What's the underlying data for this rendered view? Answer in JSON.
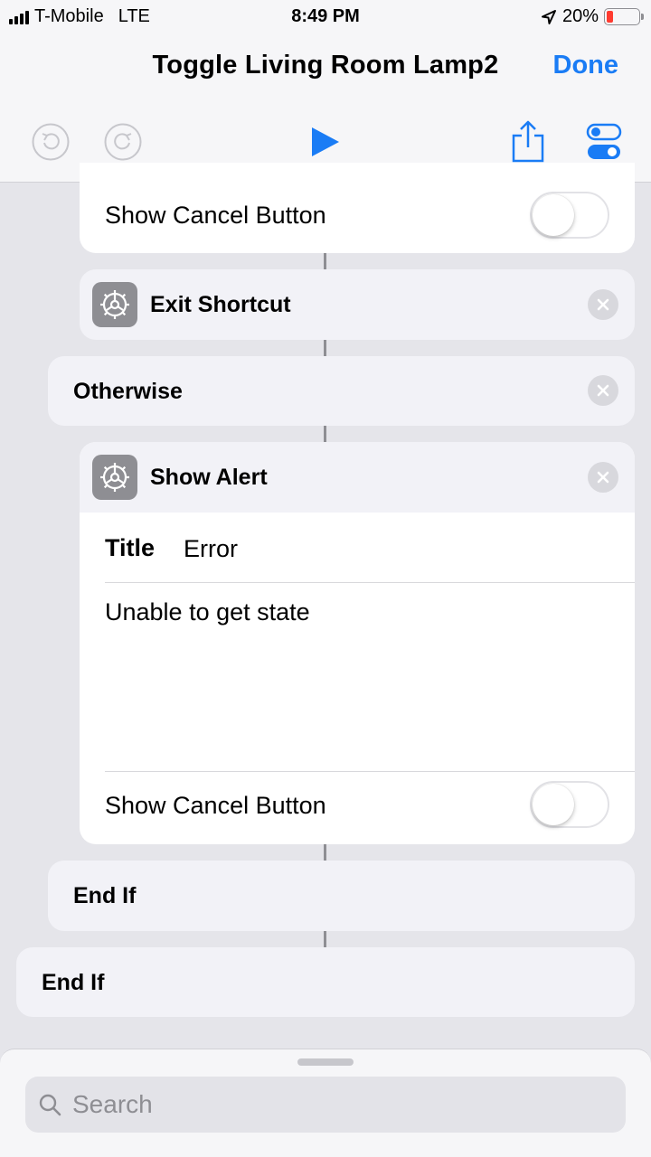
{
  "status_bar": {
    "carrier": "T-Mobile",
    "network": "LTE",
    "time": "8:49 PM",
    "battery_percent": "20%",
    "battery_level": 0.2,
    "signal_bars": 4
  },
  "nav": {
    "title": "Toggle Living Room Lamp2",
    "done_label": "Done",
    "undo_icon": "undo-icon",
    "redo_icon": "redo-icon",
    "play_icon": "play-icon",
    "share_icon": "share-icon",
    "settings_icon": "settings-toggle-icon"
  },
  "actions": {
    "top_alert": {
      "show_cancel_label": "Show Cancel Button",
      "show_cancel_enabled": false
    },
    "exit_shortcut": {
      "title": "Exit Shortcut",
      "icon": "gear-icon"
    },
    "otherwise": {
      "title": "Otherwise"
    },
    "show_alert": {
      "title": "Show Alert",
      "icon": "gear-icon",
      "title_label": "Title",
      "title_value": "Error",
      "message": "Unable to get state",
      "show_cancel_label": "Show Cancel Button",
      "show_cancel_enabled": false
    },
    "end_if_inner": {
      "title": "End If"
    },
    "end_if_outer": {
      "title": "End If"
    }
  },
  "search": {
    "placeholder": "Search",
    "icon": "search-icon"
  },
  "colors": {
    "accent": "#1a7cf5",
    "background": "#e5e5ea",
    "battery_low": "#ff3b30"
  }
}
